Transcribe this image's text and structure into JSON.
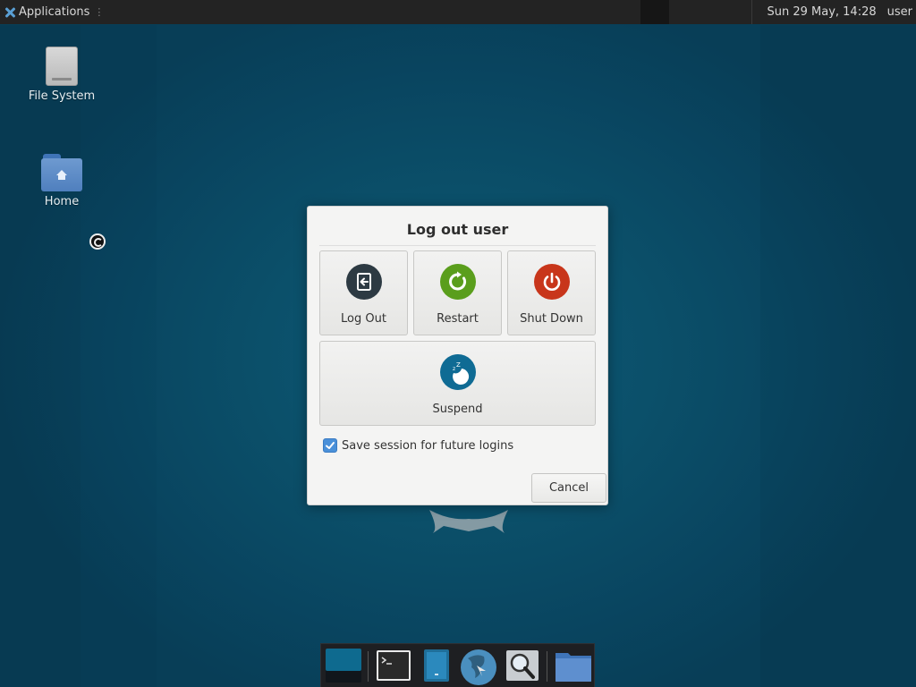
{
  "panel": {
    "applications_label": "Applications",
    "separator": "⋮",
    "clock": "Sun 29 May, 14:28",
    "user": "user"
  },
  "desktop": {
    "icons": [
      {
        "label": "File System",
        "icon": "drive-icon"
      },
      {
        "label": "Home",
        "icon": "home-folder-icon"
      }
    ]
  },
  "dialog": {
    "title": "Log out user",
    "actions": [
      {
        "label": "Log Out",
        "icon": "log-out-icon",
        "color": "#2d3a43"
      },
      {
        "label": "Restart",
        "icon": "restart-icon",
        "color": "#5a9e1c"
      },
      {
        "label": "Shut Down",
        "icon": "power-icon",
        "color": "#c8361b"
      },
      {
        "label": "Suspend",
        "icon": "suspend-moon-icon",
        "color": "#0f6b94"
      }
    ],
    "save_session": {
      "label": "Save session for future logins",
      "checked": true
    },
    "cancel_label": "Cancel"
  },
  "dock": {
    "items": [
      {
        "name": "show-desktop",
        "icon": "desktop-icon"
      },
      {
        "name": "terminal",
        "icon": "terminal-icon"
      },
      {
        "name": "app-finder",
        "icon": "app-finder-icon"
      },
      {
        "name": "web-browser",
        "icon": "globe-icon"
      },
      {
        "name": "search",
        "icon": "magnifier-icon"
      },
      {
        "name": "file-manager",
        "icon": "folder-icon"
      }
    ]
  },
  "colors": {
    "desktop_bg": "#0b4f69",
    "panel_bg": "#232323",
    "checkbox_accent": "#4a90d9"
  }
}
